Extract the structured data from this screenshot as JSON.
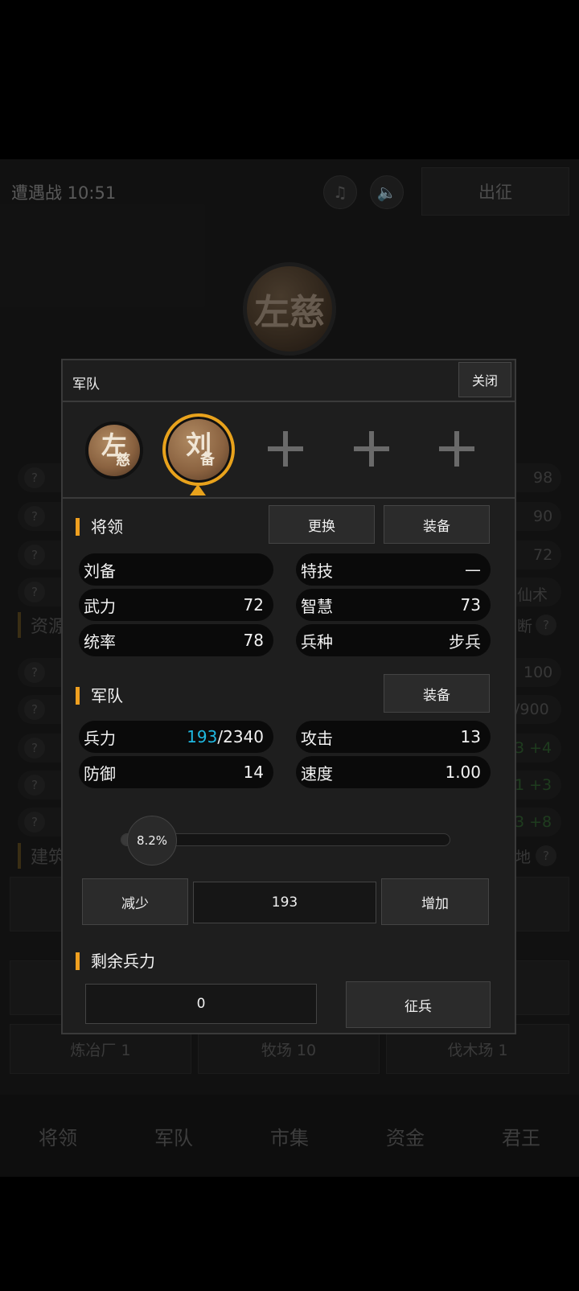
{
  "game": {
    "title": "遭遇战 10:51",
    "music_icon": "music-off-icon",
    "sound_icon": "sound-off-icon",
    "march_label": "出征",
    "big_avatar": "左慈",
    "bg_values": [
      "98",
      "90",
      "72",
      "仙术",
      "100",
      "/900",
      "3 +4",
      "1 +3",
      "3 +8"
    ],
    "bg_sections": [
      "资源",
      "建筑"
    ],
    "bg_right_labels": [
      "断",
      "地"
    ],
    "buildings": [
      "炼冶厂 1",
      "牧场 10",
      "伐木场 1"
    ],
    "nav": [
      "将领",
      "军队",
      "市集",
      "资金",
      "君王"
    ]
  },
  "dialog": {
    "title": "军队",
    "close_label": "关闭",
    "generals": [
      {
        "line1": "左",
        "line2": "慈"
      },
      {
        "line1": "刘",
        "line2": "备"
      }
    ],
    "general_section": {
      "label": "将领",
      "replace_label": "更换",
      "equip_label": "装备",
      "name": "刘备",
      "skill_label": "特技",
      "skill_value": "—",
      "force_label": "武力",
      "force_value": "72",
      "wisdom_label": "智慧",
      "wisdom_value": "73",
      "command_label": "统率",
      "command_value": "78",
      "troop_type_label": "兵种",
      "troop_type_value": "步兵"
    },
    "army_section": {
      "label": "军队",
      "equip_label": "装备",
      "troops_label": "兵力",
      "troops_current": "193",
      "troops_max": "/2340",
      "attack_label": "攻击",
      "attack_value": "13",
      "defense_label": "防御",
      "defense_value": "14",
      "speed_label": "速度",
      "speed_value": "1.00",
      "slider_text": "8.2%",
      "slider_fraction": 0.082,
      "decrease_label": "减少",
      "amount": "193",
      "increase_label": "增加"
    },
    "remaining_section": {
      "label": "剩余兵力",
      "value": "0",
      "recruit_label": "征兵"
    }
  },
  "colors": {
    "accent": "#f0a020",
    "troops_highlight": "#1fb8e0"
  }
}
